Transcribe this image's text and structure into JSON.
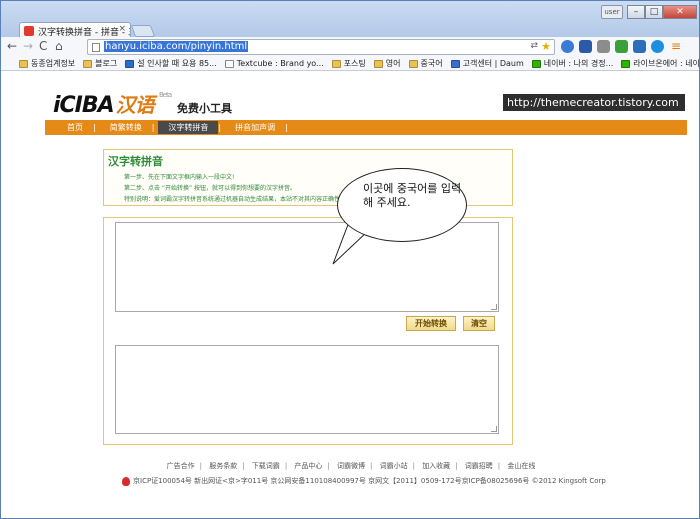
{
  "browser": {
    "tab_title": "汉字转换拼音 - 拼音 - 五笔",
    "tab_close": "×",
    "user_button": "user",
    "url": "hanyu.iciba.com/pinyin.html",
    "bookmarks": [
      "동종업계정보",
      "블로그",
      "설 인사할 때 요용 85...",
      "Textcube : Brand yo...",
      "포스팅",
      "영어",
      "중국어",
      "고객센터 | Daum",
      "네이버 : 나의 경정...",
      "라이브온에어 : 네이..."
    ],
    "bookmarks_more": "»"
  },
  "site": {
    "logo_text": "iCIBA",
    "logo_cn": "汉语",
    "beta": "Beta",
    "subtitle": "免费小工具",
    "watermark": "http://themecreator.tistory.com",
    "nav": [
      "首页",
      "简繁转换",
      "汉字转拼音",
      "拼音加声调"
    ],
    "nav_active_index": 2
  },
  "info": {
    "title": "汉字转拼音",
    "lines": [
      "第一步、先在下面文字框内输入一段中文!",
      "第二步、点击 “开始转换” 按钮，就可以得到你想要的汉字拼音。",
      "特别说明：爱词霸汉字转拼音系统通过机器自动生成结果，本站不对其内容正确性做任何保证。"
    ]
  },
  "form": {
    "convert_label": "开始转换",
    "clear_label": "清空"
  },
  "annotation": {
    "bubble_text": "이곳에 중국어를 입력해 주세요."
  },
  "footer": {
    "links": [
      "广告合作",
      "服务条款",
      "下载词霸",
      "产品中心",
      "词霸微博",
      "词霸小站",
      "加入收藏",
      "词霸招聘",
      "金山在线"
    ],
    "copyright": "京ICP证100054号  新出网证<京>字011号 京公网安备110108400997号 京网文【2011】0509-172号京ICP备08025696号 ©2012 Kingsoft Corp"
  },
  "colors": {
    "nav_bg": "#e58a16",
    "accent_green": "#2e8b3a",
    "border_gold": "#e6c774"
  }
}
